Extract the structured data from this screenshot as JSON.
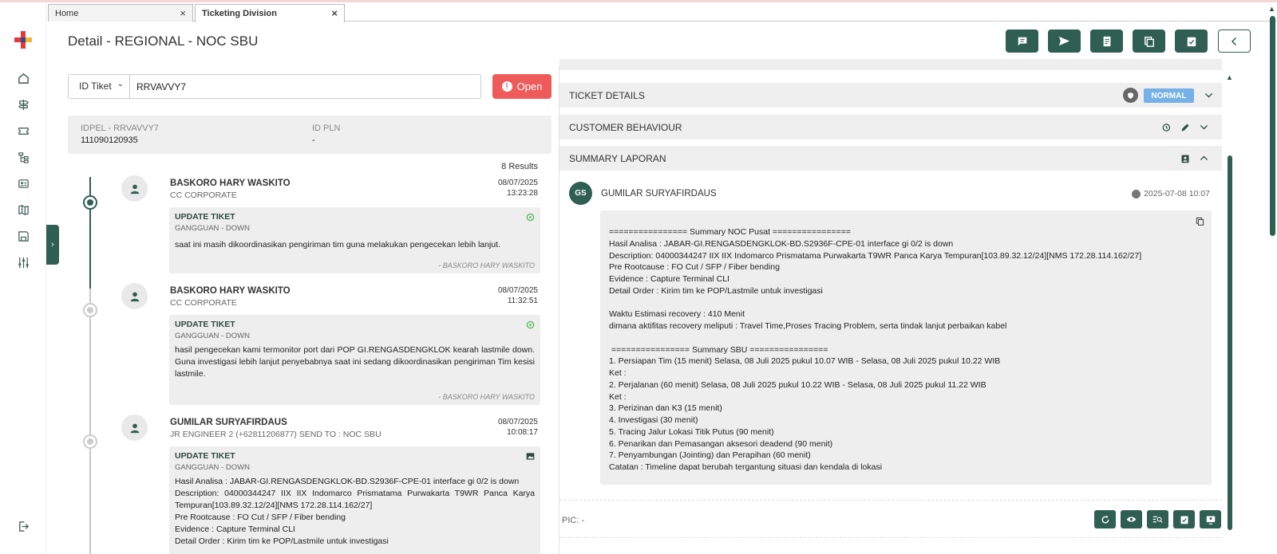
{
  "tabs": [
    {
      "label": "Home",
      "close": "×"
    },
    {
      "label": "Ticketing Division",
      "close": "×"
    }
  ],
  "page": {
    "title": "Detail - REGIONAL - NOC SBU"
  },
  "search": {
    "type_label": "ID Tiket",
    "value": "RRVAVVY7"
  },
  "status_button": {
    "label": "Open",
    "icon": "!"
  },
  "info": {
    "idpel_label": "IDPEL - RRVAVVY7",
    "idpel_value": "111090120935",
    "idpln_label": "ID PLN",
    "idpln_value": "-"
  },
  "results_label": "8 Results",
  "timeline": [
    {
      "name": "BASKORO HARY WASKITO",
      "role": "CC CORPORATE",
      "date": "08/07/2025",
      "time": "13:23:28",
      "card_title": "UPDATE TIKET",
      "card_sub": "GANGGUAN - DOWN",
      "body": "saat ini masih dikoordinasikan pengiriman tim guna melakukan pengecekan lebih lanjut.",
      "sign": "- BASKORO HARY WASKITO"
    },
    {
      "name": "BASKORO HARY WASKITO",
      "role": "CC CORPORATE",
      "date": "08/07/2025",
      "time": "11:32:51",
      "card_title": "UPDATE TIKET",
      "card_sub": "GANGGUAN - DOWN",
      "body": "hasil pengecekan kami  termonitor port dari POP GI.RENGASDENGKLOK kearah lastmile down. Guna investigasi lebih lanjut penyebabnya saat ini sedang dikoordinasikan pengiriman Tim kesisi lastmile.",
      "sign": "- BASKORO HARY WASKITO"
    },
    {
      "name": "GUMILAR SURYAFIRDAUS",
      "role": "JR ENGINEER 2 (+62811206877) SEND TO : NOC SBU",
      "date": "08/07/2025",
      "time": "10:08:17",
      "card_title": "UPDATE TIKET",
      "card_sub": "GANGGUAN - DOWN",
      "body": "Hasil Analisa : JABAR-GI.RENGASDENGKLOK-BD.S2936F-CPE-01 interface gi 0/2 is down\nDescription: 04000344247 IIX IIX Indomarco Prismatama Purwakarta T9WR Panca Karya Tempuran[103.89.32.12/24][NMS 172.28.114.162/27]\nPre Rootcause : FO Cut / SFP / Fiber bending\nEvidence : Capture Terminal CLI\nDetail Order : Kirim tim ke POP/Lastmile untuk investigasi",
      "sign": ""
    }
  ],
  "accordions": {
    "ticket_details": "TICKET DETAILS",
    "customer_behaviour": "CUSTOMER BEHAVIOUR",
    "summary_laporan": "SUMMARY LAPORAN",
    "priority_badge": "NORMAL"
  },
  "summary": {
    "author_initials": "GS",
    "author": "GUMILAR SURYAFIRDAUS",
    "timestamp": "2025-07-08 10:07",
    "lines": [
      "================ Summary NOC Pusat ================",
      "Hasil Analisa : JABAR-GI.RENGASDENGKLOK-BD.S2936F-CPE-01 interface gi 0/2 is down",
      "Description: 04000344247 IIX IIX Indomarco Prismatama Purwakarta T9WR Panca Karya Tempuran[103.89.32.12/24][NMS 172.28.114.162/27]",
      "Pre Rootcause : FO Cut / SFP / Fiber bending",
      "Evidence : Capture Terminal CLI",
      "Detail Order : Kirim tim ke POP/Lastmile untuk investigasi",
      "",
      "Waktu Estimasi recovery : 410 Menit",
      "dimana aktifitas recovery meliputi : Travel Time,Proses Tracing Problem, serta tindak lanjut perbaikan kabel",
      "",
      " ================ Summary SBU ================",
      "1. Persiapan Tim (15 menit) Selasa, 08 Juli 2025 pukul 10.07 WIB - Selasa, 08 Juli 2025 pukul 10.22 WIB",
      "Ket :",
      "2. Perjalanan (60 menit) Selasa, 08 Juli 2025 pukul 10.22 WIB - Selasa, 08 Juli 2025 pukul 11.22 WIB",
      "Ket :",
      "3. Perizinan dan K3 (15 menit)",
      "4. Investigasi (30 menit)",
      "5. Tracing Jalur Lokasi Titik Putus (90 menit)",
      "6. Penarikan dan Pemasangan aksesori deadend (90 menit)",
      "7. Penyambungan (Jointing) dan Perapihan (60 menit)",
      "Catatan : Timeline dapat berubah tergantung situasi dan kendala di lokasi"
    ]
  },
  "pic": {
    "label": "PIC:",
    "value": "-"
  },
  "colors": {
    "primary": "#2f5e52",
    "danger": "#ef5b5b",
    "badge": "#75b0e6"
  }
}
